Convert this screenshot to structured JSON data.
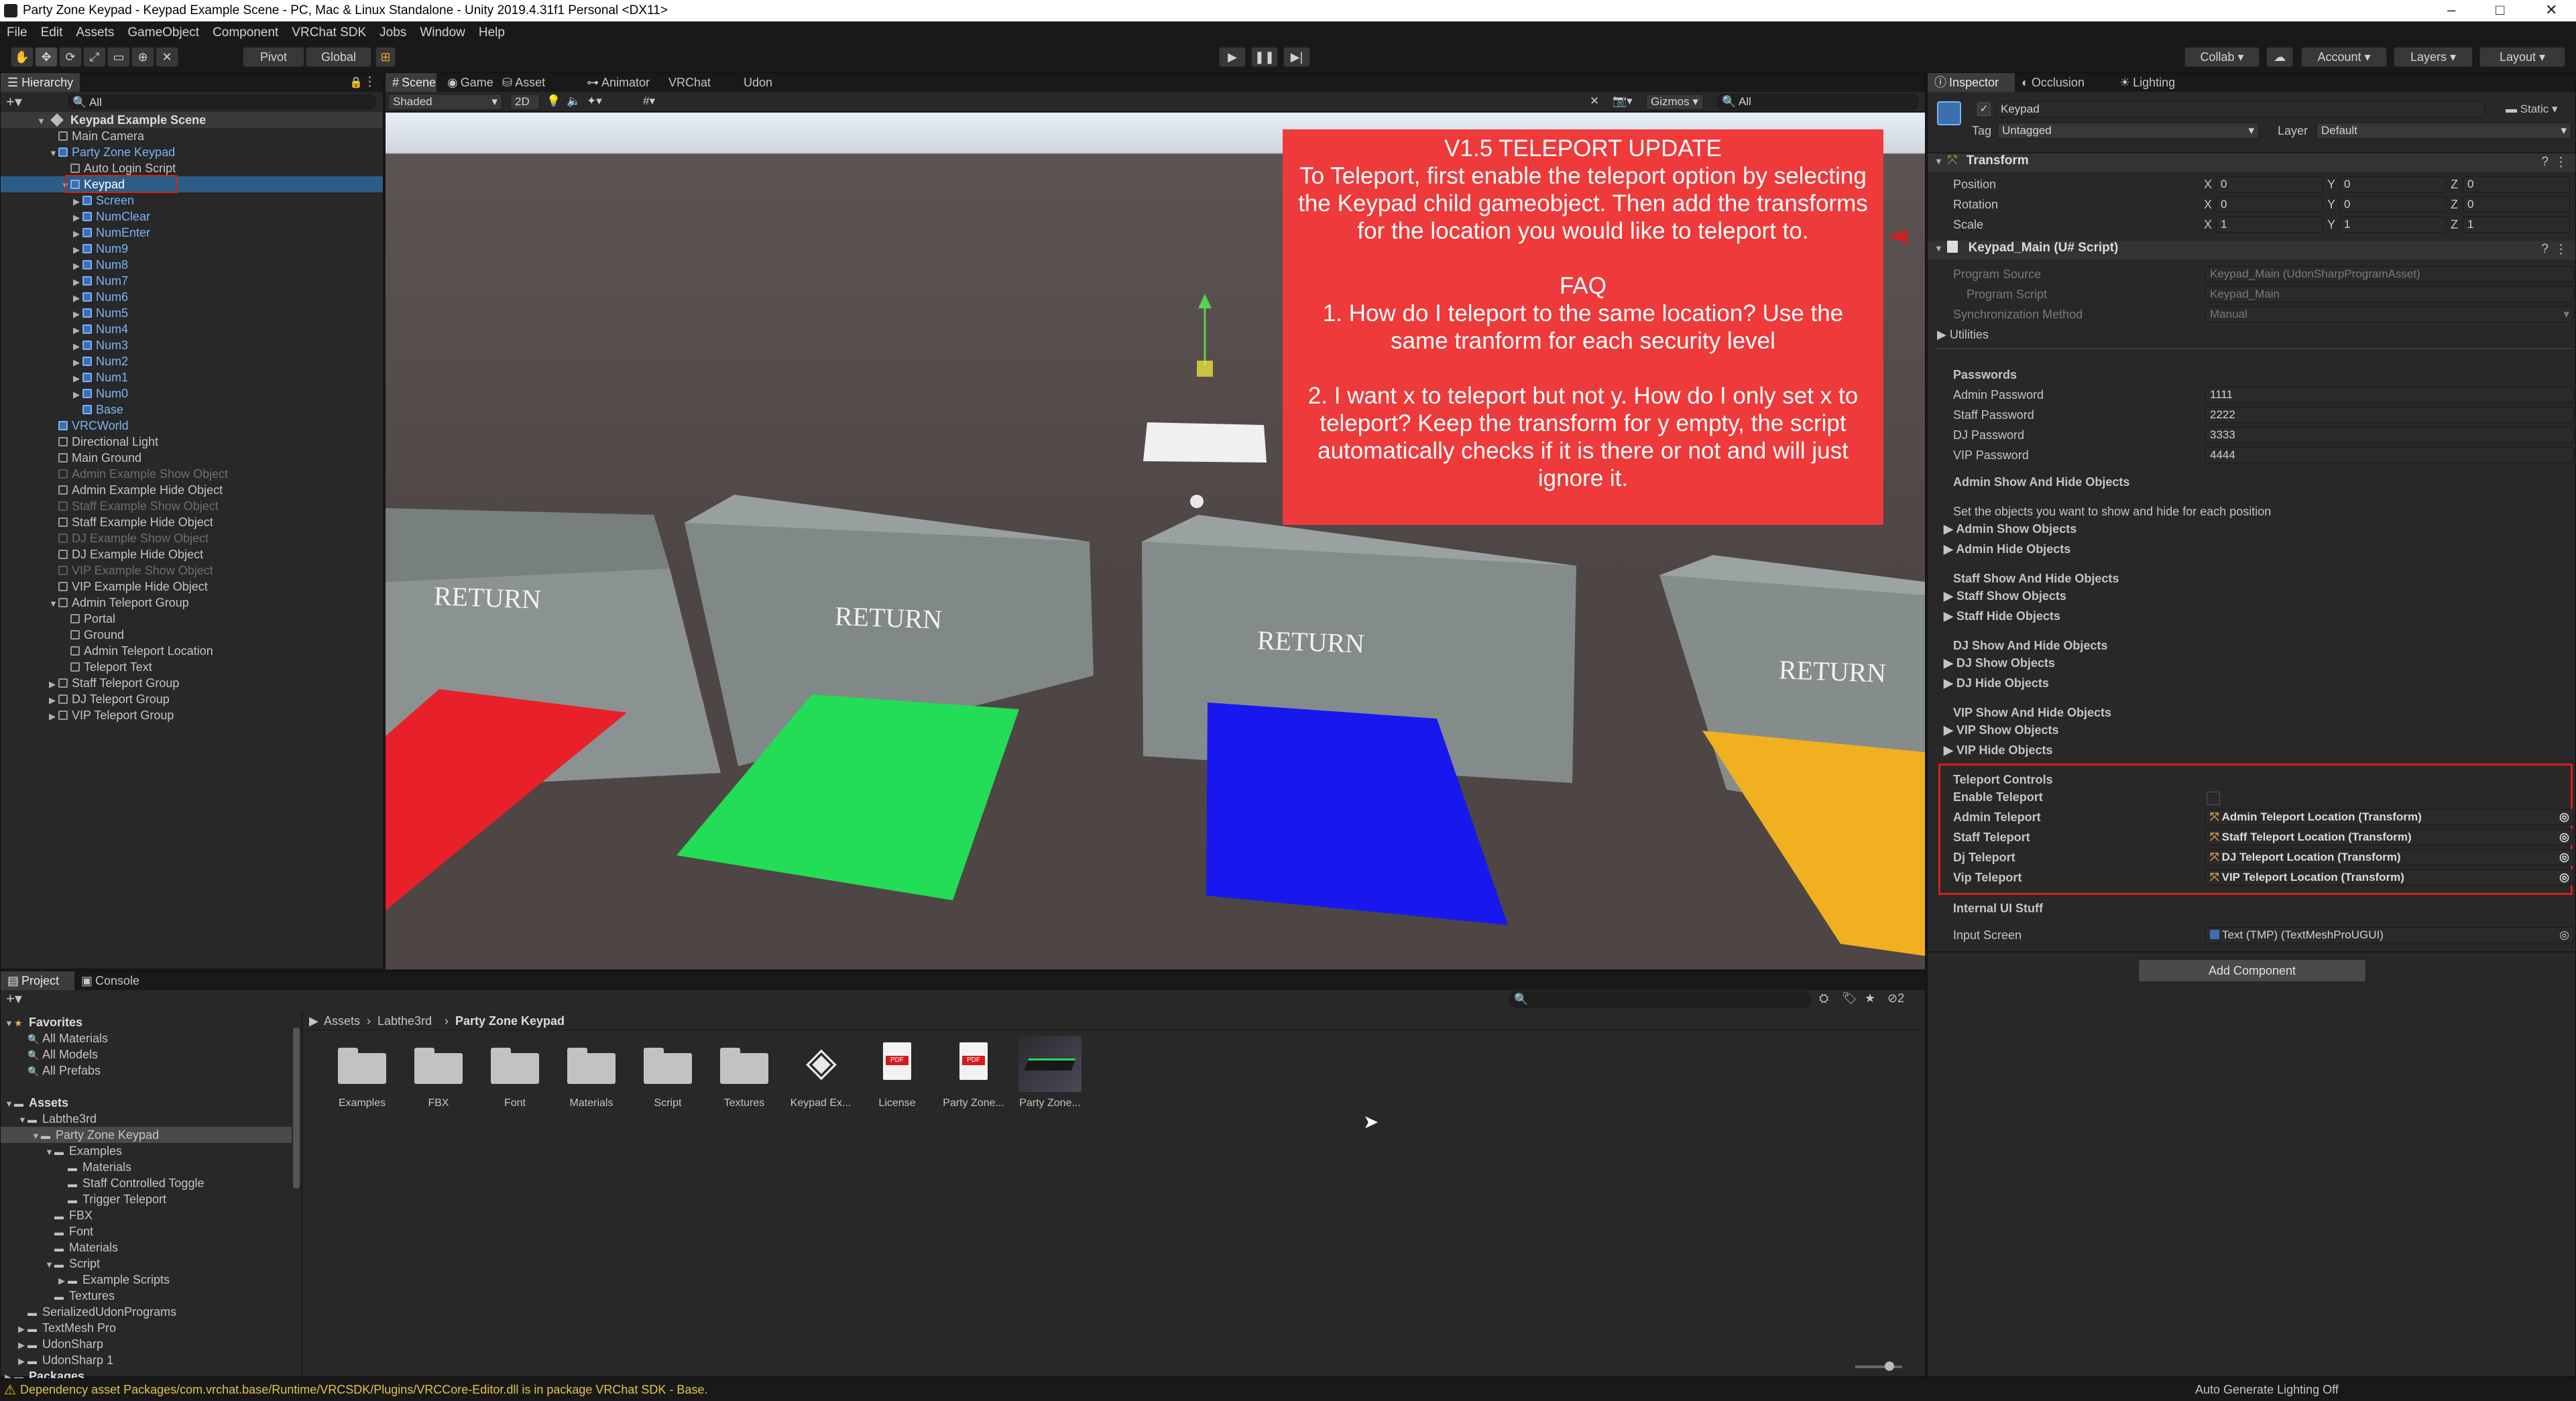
{
  "window": {
    "title": "Party Zone Keypad - Keypad Example Scene - PC, Mac & Linux Standalone - Unity 2019.4.31f1 Personal <DX11>",
    "minimize": "–",
    "maximize": "□",
    "close": "✕"
  },
  "menu": [
    "File",
    "Edit",
    "Assets",
    "GameObject",
    "Component",
    "VRChat SDK",
    "Jobs",
    "Window",
    "Help"
  ],
  "toolbar": {
    "pivot": "Pivot",
    "global": "Global",
    "collab": "Collab ▾",
    "account": "Account",
    "layers": "Layers",
    "layout": "Layout"
  },
  "hierarchy": {
    "tab": "Hierarchy",
    "search_placeholder": "All",
    "scene": "Keypad Example Scene",
    "items": [
      {
        "label": "Main Camera",
        "style": "normal",
        "indent": 1,
        "arrow": ""
      },
      {
        "label": "Party Zone Keypad",
        "style": "prefab",
        "indent": 1,
        "arrow": "▼"
      },
      {
        "label": "Auto Login Script",
        "style": "normal",
        "indent": 2,
        "arrow": ""
      },
      {
        "label": "Keypad",
        "style": "selected",
        "indent": 2,
        "arrow": "▼"
      },
      {
        "label": "Screen",
        "style": "prefab",
        "indent": 3,
        "arrow": "▶"
      },
      {
        "label": "NumClear",
        "style": "prefab",
        "indent": 3,
        "arrow": "▶"
      },
      {
        "label": "NumEnter",
        "style": "prefab",
        "indent": 3,
        "arrow": "▶"
      },
      {
        "label": "Num9",
        "style": "prefab",
        "indent": 3,
        "arrow": "▶"
      },
      {
        "label": "Num8",
        "style": "prefab",
        "indent": 3,
        "arrow": "▶"
      },
      {
        "label": "Num7",
        "style": "prefab",
        "indent": 3,
        "arrow": "▶"
      },
      {
        "label": "Num6",
        "style": "prefab",
        "indent": 3,
        "arrow": "▶"
      },
      {
        "label": "Num5",
        "style": "prefab",
        "indent": 3,
        "arrow": "▶"
      },
      {
        "label": "Num4",
        "style": "prefab",
        "indent": 3,
        "arrow": "▶"
      },
      {
        "label": "Num3",
        "style": "prefab",
        "indent": 3,
        "arrow": "▶"
      },
      {
        "label": "Num2",
        "style": "prefab",
        "indent": 3,
        "arrow": "▶"
      },
      {
        "label": "Num1",
        "style": "prefab",
        "indent": 3,
        "arrow": "▶"
      },
      {
        "label": "Num0",
        "style": "prefab",
        "indent": 3,
        "arrow": "▶"
      },
      {
        "label": "Base",
        "style": "prefab",
        "indent": 3,
        "arrow": ""
      },
      {
        "label": "VRCWorld",
        "style": "prefab",
        "indent": 1,
        "arrow": ""
      },
      {
        "label": "Directional Light",
        "style": "normal",
        "indent": 1,
        "arrow": ""
      },
      {
        "label": "Main Ground",
        "style": "normal",
        "indent": 1,
        "arrow": ""
      },
      {
        "label": "Admin Example Show Object",
        "style": "dim",
        "indent": 1,
        "arrow": ""
      },
      {
        "label": "Admin Example Hide Object",
        "style": "normal",
        "indent": 1,
        "arrow": ""
      },
      {
        "label": "Staff Example Show Object",
        "style": "dim",
        "indent": 1,
        "arrow": ""
      },
      {
        "label": "Staff Example Hide Object",
        "style": "normal",
        "indent": 1,
        "arrow": ""
      },
      {
        "label": "DJ Example Show Object",
        "style": "dim",
        "indent": 1,
        "arrow": ""
      },
      {
        "label": "DJ Example Hide Object",
        "style": "normal",
        "indent": 1,
        "arrow": ""
      },
      {
        "label": "VIP Example Show Object",
        "style": "dim",
        "indent": 1,
        "arrow": ""
      },
      {
        "label": "VIP Example Hide Object",
        "style": "normal",
        "indent": 1,
        "arrow": ""
      },
      {
        "label": "Admin Teleport Group",
        "style": "normal",
        "indent": 1,
        "arrow": "▼"
      },
      {
        "label": "Portal",
        "style": "normal",
        "indent": 2,
        "arrow": ""
      },
      {
        "label": "Ground",
        "style": "normal",
        "indent": 2,
        "arrow": ""
      },
      {
        "label": "Admin Teleport Location",
        "style": "normal",
        "indent": 2,
        "arrow": ""
      },
      {
        "label": "Teleport Text",
        "style": "normal",
        "indent": 2,
        "arrow": ""
      },
      {
        "label": "Staff Teleport Group",
        "style": "normal",
        "indent": 1,
        "arrow": "▶"
      },
      {
        "label": "DJ Teleport Group",
        "style": "normal",
        "indent": 1,
        "arrow": "▶"
      },
      {
        "label": "VIP Teleport Group",
        "style": "normal",
        "indent": 1,
        "arrow": "▶"
      }
    ]
  },
  "scene_tabs": [
    "Scene",
    "Game",
    "Asset Store",
    "Animator",
    "VRChat SDK",
    "Udon Graph"
  ],
  "scene_toolbar": {
    "shading": "Shaded",
    "mode2d": "2D",
    "gizmos": "Gizmos",
    "search_placeholder": "All"
  },
  "scene_view": {
    "return_labels": [
      "RETURN",
      "RETURN",
      "RETURN",
      "RETURN"
    ],
    "pad_colors": [
      "#e8202a",
      "#22dd55",
      "#1818ee",
      "#f0b020"
    ],
    "banner_color": "#ee3a3a",
    "banner_lines": [
      "V1.5 TELEPORT UPDATE",
      "To Teleport, first enable the teleport option by selecting the Keypad child gameobject. Then add the transforms for the location you would like to teleport to.",
      "FAQ",
      "1. How do I teleport to the same location? Use the same tranform for each security level",
      "2. I want x to teleport but not y. How do I only set x to teleport? Keep the transform for y empty, the script automatically checks if it is there or not and will just ignore it."
    ]
  },
  "inspector": {
    "tabs": [
      "Inspector",
      "Occlusion",
      "Lighting"
    ],
    "object_name": "Keypad",
    "static_label": "Static",
    "tag_label": "Tag",
    "tag_value": "Untagged",
    "layer_label": "Layer",
    "layer_value": "Default",
    "transform": {
      "header": "Transform",
      "rows": [
        {
          "label": "Position",
          "x": "0",
          "y": "0",
          "z": "0"
        },
        {
          "label": "Rotation",
          "x": "0",
          "y": "0",
          "z": "0"
        },
        {
          "label": "Scale",
          "x": "1",
          "y": "1",
          "z": "1"
        }
      ]
    },
    "script": {
      "header": "Keypad_Main (U# Script)",
      "program_source_label": "Program Source",
      "program_source_value": "Keypad_Main (UdonSharpProgramAsset)",
      "program_script_label": "Program Script",
      "program_script_value": "Keypad_Main",
      "sync_label": "Synchronization Method",
      "sync_value": "Manual",
      "utilities": "Utilities"
    },
    "passwords": {
      "header": "Passwords",
      "rows": [
        {
          "label": "Admin Password",
          "value": "1111"
        },
        {
          "label": "Staff Password",
          "value": "2222"
        },
        {
          "label": "DJ Password",
          "value": "3333"
        },
        {
          "label": "VIP Password",
          "value": "4444"
        }
      ]
    },
    "show_hide": {
      "header": "Admin Show And Hide Objects",
      "help": "Set the objects you want to show and hide for each position",
      "admin_show": "Admin Show Objects",
      "admin_hide": "Admin Hide Objects",
      "staff_header": "Staff Show And Hide Objects",
      "staff_show": "Staff Show Objects",
      "staff_hide": "Staff Hide Objects",
      "dj_header": "DJ Show And Hide Objects",
      "dj_show": "DJ Show Objects",
      "dj_hide": "DJ Hide Objects",
      "vip_header": "VIP Show And Hide Objects",
      "vip_show": "VIP Show Objects",
      "vip_hide": "VIP Hide Objects"
    },
    "teleport": {
      "header": "Teleport Controls",
      "enable_label": "Enable Teleport",
      "rows": [
        {
          "label": "Admin Teleport",
          "value": "Admin Teleport Location (Transform)"
        },
        {
          "label": "Staff Teleport",
          "value": "Staff Teleport Location (Transform)"
        },
        {
          "label": "Dj Teleport",
          "value": "DJ Teleport Location (Transform)"
        },
        {
          "label": "Vip Teleport",
          "value": "VIP Teleport Location (Transform)"
        }
      ]
    },
    "internal": {
      "header": "Internal UI Stuff",
      "input_label": "Input Screen",
      "input_value": "Text (TMP) (TextMeshProUGUI)"
    },
    "add_component": "Add Component"
  },
  "project": {
    "tabs": [
      "Project",
      "Console"
    ],
    "hidden_count": "2",
    "breadcrumb": [
      "Assets",
      "Labthe3rd",
      "Party Zone Keypad"
    ],
    "tree": [
      {
        "label": "Favorites",
        "indent": 0,
        "arrow": "▼",
        "kind": "fav-header"
      },
      {
        "label": "All Materials",
        "indent": 1,
        "arrow": "",
        "kind": "search"
      },
      {
        "label": "All Models",
        "indent": 1,
        "arrow": "",
        "kind": "search"
      },
      {
        "label": "All Prefabs",
        "indent": 1,
        "arrow": "",
        "kind": "search"
      },
      {
        "label": "",
        "indent": 0,
        "arrow": "",
        "kind": "gap"
      },
      {
        "label": "Assets",
        "indent": 0,
        "arrow": "▼",
        "kind": "header"
      },
      {
        "label": "Labthe3rd",
        "indent": 1,
        "arrow": "▼",
        "kind": "folder"
      },
      {
        "label": "Party Zone Keypad",
        "indent": 2,
        "arrow": "▼",
        "kind": "folder-selected"
      },
      {
        "label": "Examples",
        "indent": 3,
        "arrow": "▼",
        "kind": "folder"
      },
      {
        "label": "Materials",
        "indent": 4,
        "arrow": "",
        "kind": "folder"
      },
      {
        "label": "Staff Controlled Toggle",
        "indent": 4,
        "arrow": "",
        "kind": "folder"
      },
      {
        "label": "Trigger Teleport",
        "indent": 4,
        "arrow": "",
        "kind": "folder"
      },
      {
        "label": "FBX",
        "indent": 3,
        "arrow": "",
        "kind": "folder"
      },
      {
        "label": "Font",
        "indent": 3,
        "arrow": "",
        "kind": "folder"
      },
      {
        "label": "Materials",
        "indent": 3,
        "arrow": "",
        "kind": "folder"
      },
      {
        "label": "Script",
        "indent": 3,
        "arrow": "▼",
        "kind": "folder"
      },
      {
        "label": "Example Scripts",
        "indent": 4,
        "arrow": "▶",
        "kind": "folder"
      },
      {
        "label": "Textures",
        "indent": 3,
        "arrow": "",
        "kind": "folder"
      },
      {
        "label": "SerializedUdonPrograms",
        "indent": 1,
        "arrow": "",
        "kind": "folder"
      },
      {
        "label": "TextMesh Pro",
        "indent": 1,
        "arrow": "▶",
        "kind": "folder"
      },
      {
        "label": "UdonSharp",
        "indent": 1,
        "arrow": "▶",
        "kind": "folder"
      },
      {
        "label": "UdonSharp 1",
        "indent": 1,
        "arrow": "▶",
        "kind": "folder"
      },
      {
        "label": "Packages",
        "indent": 0,
        "arrow": "▶",
        "kind": "header"
      }
    ],
    "assets": [
      {
        "label": "Examples",
        "kind": "folder"
      },
      {
        "label": "FBX",
        "kind": "folder"
      },
      {
        "label": "Font",
        "kind": "folder"
      },
      {
        "label": "Materials",
        "kind": "folder"
      },
      {
        "label": "Script",
        "kind": "folder"
      },
      {
        "label": "Textures",
        "kind": "folder"
      },
      {
        "label": "Keypad Ex...",
        "kind": "unity"
      },
      {
        "label": "License",
        "kind": "pdf"
      },
      {
        "label": "Party Zone...",
        "kind": "pdf"
      },
      {
        "label": "Party Zone...",
        "kind": "prefab"
      }
    ]
  },
  "status": {
    "warning": "Dependency asset Packages/com.vrchat.base/Runtime/VRCSDK/Plugins/VRCCore-Editor.dll is in package VRChat SDK - Base.",
    "right": "Auto Generate Lighting Off"
  }
}
